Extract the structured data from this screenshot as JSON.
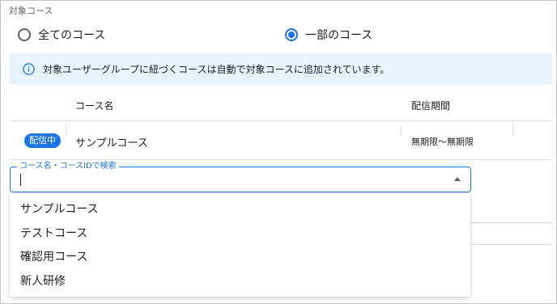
{
  "section_label": "対象コース",
  "radio": {
    "all_label": "全てのコース",
    "some_label": "一部のコース",
    "selected": "some"
  },
  "info_banner": {
    "icon": "info-icon",
    "text": "対象ユーザーグループに紐づくコースは自動で対象コースに追加されています。"
  },
  "table": {
    "headers": {
      "course": "コース名",
      "period": "配信期間"
    },
    "rows": [
      {
        "status": "配信中",
        "course": "サンプルコース",
        "period": "無期限〜無期限"
      }
    ]
  },
  "search": {
    "label": "コース名・コースIDで検索",
    "value": ""
  },
  "dropdown": {
    "options": [
      "サンプルコース",
      "テストコース",
      "確認用コース",
      "新人研修"
    ]
  },
  "colors": {
    "accent": "#1a73e8",
    "banner_bg": "#e8f4fb"
  }
}
